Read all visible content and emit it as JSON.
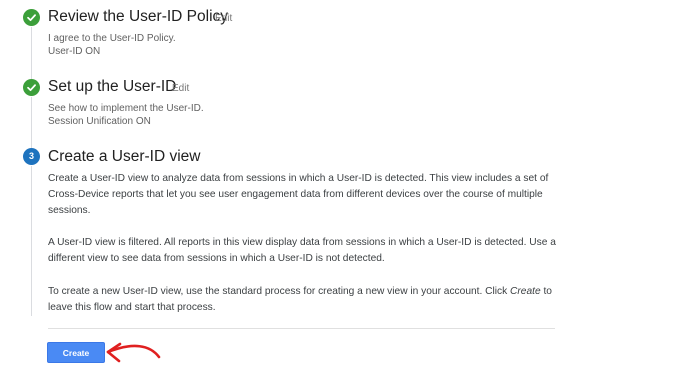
{
  "steps": [
    {
      "title": "Review the User-ID Policy",
      "edit_label": "Edit",
      "details": [
        "I agree to the User-ID Policy.",
        "User-ID ON"
      ]
    },
    {
      "title": "Set up the User-ID",
      "edit_label": "Edit",
      "details": [
        "See how to implement the User-ID.",
        "Session Unification ON"
      ]
    },
    {
      "number": "3",
      "title": "Create a User-ID view",
      "paragraphs": [
        "Create a User-ID view to analyze data from sessions in which a User-ID is detected. This view includes a set of Cross-Device reports that let you see user engagement data from different devices over the course of multiple sessions.",
        "A User-ID view is filtered. All reports in this view display data from sessions in which a User-ID is detected. Use a different view to see data from sessions in which a User-ID is not detected."
      ],
      "final_paragraph": {
        "before": "To create a new User-ID view, use the standard process for creating a new view in your account. Click ",
        "emphasis": "Create",
        "after": " to leave this flow and start that process."
      }
    }
  ],
  "create_button_label": "Create",
  "colors": {
    "done_check": "#3c9f3a",
    "current_step": "#1e73be",
    "primary_button": "#4a8af4",
    "annotation_arrow": "#e02020"
  },
  "icons": {
    "completed_step": "check-circle-icon",
    "annotation": "red-arrow-icon"
  }
}
